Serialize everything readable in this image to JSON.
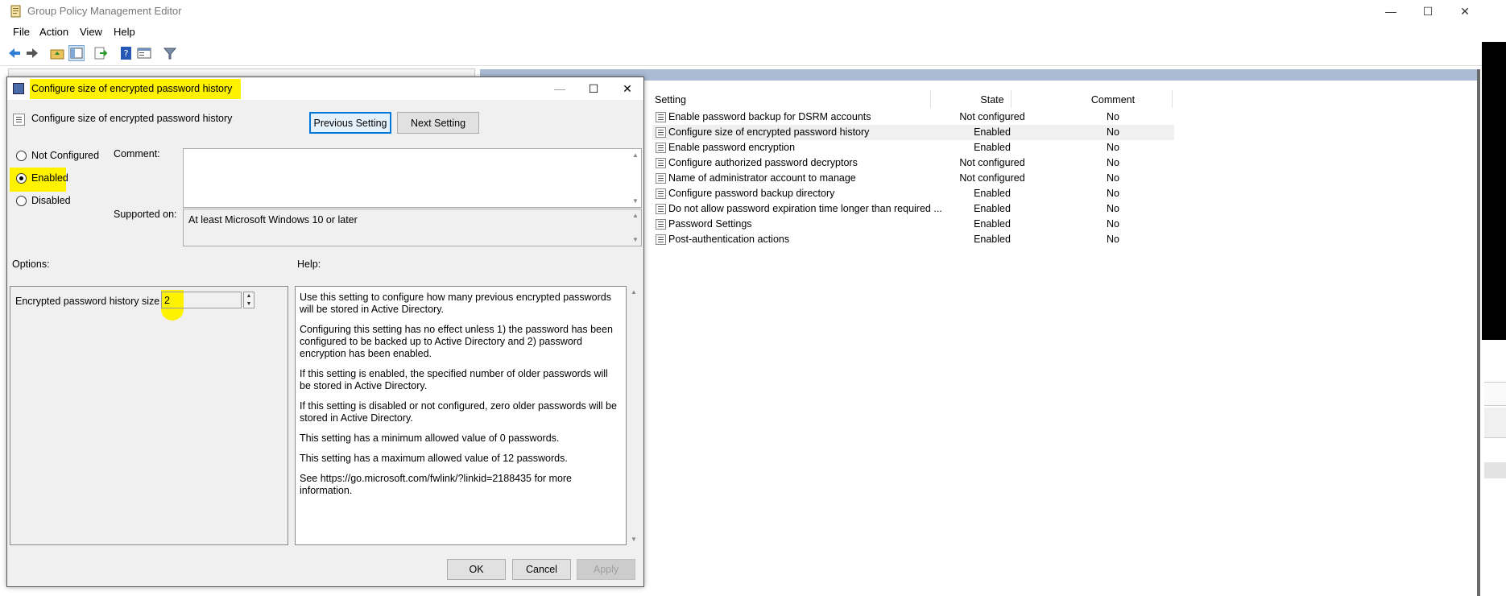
{
  "app": {
    "title": "Group Policy Management Editor",
    "window_controls": {
      "minimize": "—",
      "maximize": "☐",
      "close": "✕"
    }
  },
  "menu": [
    "File",
    "Action",
    "View",
    "Help"
  ],
  "toolbar_icons": [
    "back-icon",
    "forward-icon",
    "up-folder-icon",
    "show-hide-tree-icon",
    "export-icon",
    "help-icon",
    "properties-icon",
    "filter-icon"
  ],
  "policy_list": {
    "columns": {
      "setting": "Setting",
      "state": "State",
      "comment": "Comment"
    },
    "rows": [
      {
        "name": "Enable password backup for DSRM accounts",
        "state": "Not configured",
        "comment": "No"
      },
      {
        "name": "Configure size of encrypted password history",
        "state": "Enabled",
        "comment": "No"
      },
      {
        "name": "Enable password encryption",
        "state": "Enabled",
        "comment": "No"
      },
      {
        "name": "Configure authorized password decryptors",
        "state": "Not configured",
        "comment": "No"
      },
      {
        "name": "Name of administrator account to manage",
        "state": "Not configured",
        "comment": "No"
      },
      {
        "name": "Configure password backup directory",
        "state": "Enabled",
        "comment": "No"
      },
      {
        "name": "Do not allow password expiration time longer than required ...",
        "state": "Enabled",
        "comment": "No"
      },
      {
        "name": "Password Settings",
        "state": "Enabled",
        "comment": "No"
      },
      {
        "name": "Post-authentication actions",
        "state": "Enabled",
        "comment": "No"
      }
    ]
  },
  "dialog": {
    "title": "Configure size of encrypted password history",
    "subtitle": "Configure size of encrypted password history",
    "prev_button": "Previous Setting",
    "next_button": "Next Setting",
    "radio": {
      "not_configured": "Not Configured",
      "enabled": "Enabled",
      "disabled": "Disabled",
      "selected": "Enabled"
    },
    "comment_label": "Comment:",
    "comment_value": "",
    "supported_label": "Supported on:",
    "supported_value": "At least Microsoft Windows 10 or later",
    "options_label": "Options:",
    "help_label": "Help:",
    "option_history_label": "Encrypted password history size",
    "option_history_value": "2",
    "help_paragraphs": [
      "Use this setting to configure how many previous encrypted passwords will be stored in Active Directory.",
      "Configuring this setting has no effect unless 1) the password has been configured to be backed up to Active Directory and 2) password encryption has been enabled.",
      "If this setting is enabled, the specified number of older passwords will be stored in Active Directory.",
      "If this setting is disabled or not configured, zero older passwords will be stored in Active Directory.",
      "This setting has a minimum allowed value of 0 passwords.",
      "This setting has a maximum allowed value of 12 passwords.",
      "See https://go.microsoft.com/fwlink/?linkid=2188435 for more information."
    ],
    "ok_button": "OK",
    "cancel_button": "Cancel",
    "apply_button": "Apply"
  },
  "colors": {
    "highlight": "#fff200",
    "focus_border": "#0078d7",
    "header_bar": "#aabbd3"
  }
}
